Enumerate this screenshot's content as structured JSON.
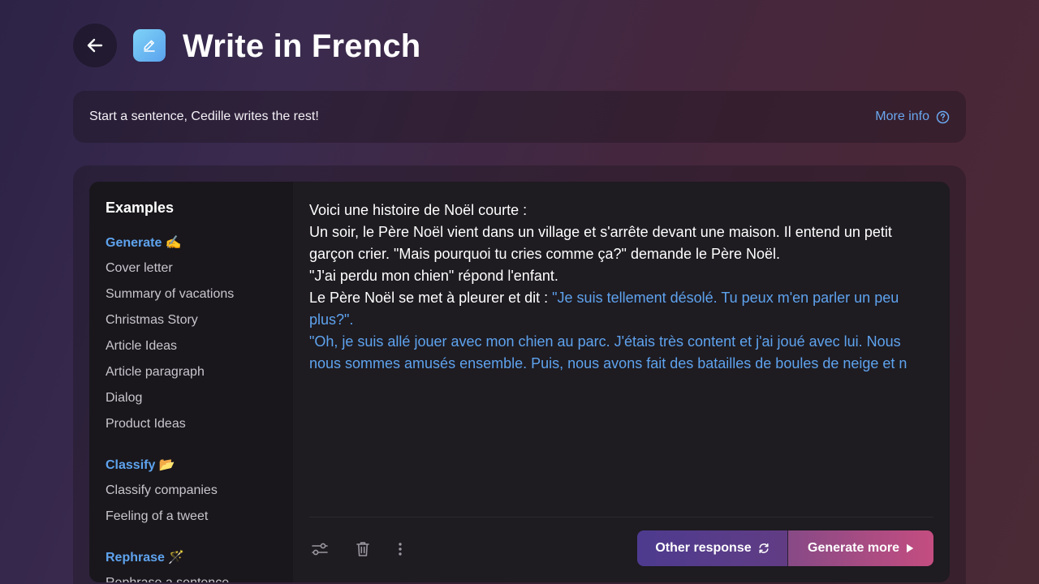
{
  "header": {
    "title": "Write in French",
    "back_icon": "arrow-left-icon",
    "app_icon": "pencil-edit-icon"
  },
  "info_bar": {
    "text": "Start a sentence, Cedille writes the rest!",
    "more_info_label": "More info"
  },
  "sidebar": {
    "title": "Examples",
    "sections": [
      {
        "title": "Generate ✍️",
        "items": [
          "Cover letter",
          "Summary of vacations",
          "Christmas Story",
          "Article Ideas",
          "Article paragraph",
          "Dialog",
          "Product Ideas"
        ]
      },
      {
        "title": "Classify 📂",
        "items": [
          "Classify companies",
          "Feeling of a tweet"
        ]
      },
      {
        "title": "Rephrase 🪄",
        "items": [
          "Rephrase a sentence"
        ]
      }
    ]
  },
  "editor": {
    "prompt_lines": [
      "Voici une histoire de Noël courte :",
      "Un soir, le Père Noël vient dans un village et s'arrête devant une maison. Il entend un petit garçon crier. \"Mais pourquoi tu cries comme ça?\" demande le Père Noël.",
      "\"J'ai perdu mon chien\" répond l'enfant.",
      "Le Père Noël se met à pleurer et dit : "
    ],
    "generated_inline": "\"Je suis tellement désolé. Tu peux m'en parler un peu plus?\".",
    "generated_line": "\"Oh, je suis allé jouer avec mon chien au parc. J'étais très content et j'ai joué avec lui. Nous nous sommes amusés ensemble. Puis, nous avons fait des batailles de boules de neige et n"
  },
  "toolbar": {
    "settings_icon": "sliders-icon",
    "delete_icon": "trash-icon",
    "more_icon": "more-vertical-icon",
    "other_response_label": "Other response",
    "generate_more_label": "Generate more"
  },
  "colors": {
    "accent": "#5ea3ee",
    "button_left": "#4d3b8f",
    "button_right": "#c44d80"
  }
}
